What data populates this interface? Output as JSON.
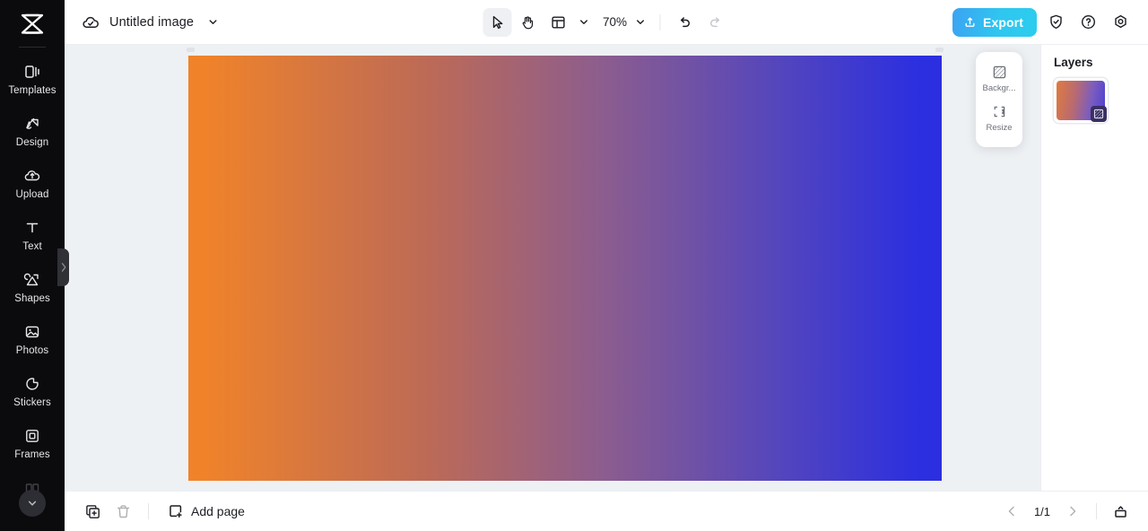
{
  "app": {
    "logo_icon": "capcut-logo-icon",
    "accent_export_from": "#3ba3f2",
    "accent_export_to": "#2ccdee",
    "canvas_gradient_from": "#f0832a",
    "canvas_gradient_to": "#2b2fe0",
    "workspace_bg": "#eef1f4",
    "sidebar_bg": "#0b0b0d"
  },
  "sidebar": {
    "items": [
      {
        "label": "Templates",
        "icon": "templates-icon"
      },
      {
        "label": "Design",
        "icon": "design-icon"
      },
      {
        "label": "Upload",
        "icon": "upload-cloud-icon"
      },
      {
        "label": "Text",
        "icon": "text-icon"
      },
      {
        "label": "Shapes",
        "icon": "shapes-icon"
      },
      {
        "label": "Photos",
        "icon": "photos-icon"
      },
      {
        "label": "Stickers",
        "icon": "stickers-icon"
      },
      {
        "label": "Frames",
        "icon": "frames-icon"
      }
    ],
    "collapse_icon": "chevron-right-icon",
    "more_icon": "chevron-down-icon"
  },
  "topbar": {
    "cloud_icon": "cloud-saved-icon",
    "doc_title": "Untitled image",
    "title_chevron_icon": "chevron-down-icon",
    "tools": [
      {
        "name": "select-tool",
        "icon": "cursor-arrow-icon",
        "active": true
      },
      {
        "name": "hand-tool",
        "icon": "hand-icon",
        "active": false
      },
      {
        "name": "layout-tool",
        "icon": "layout-grid-icon",
        "active": false
      }
    ],
    "layout_chevron_icon": "chevron-down-icon",
    "zoom_value": "70%",
    "zoom_chevron_icon": "chevron-down-icon",
    "undo_icon": "undo-arrow-icon",
    "redo_icon": "redo-arrow-icon",
    "redo_disabled": true,
    "export_label": "Export",
    "export_icon": "export-upload-icon",
    "shield_icon": "shield-check-icon",
    "help_icon": "question-circle-icon",
    "settings_icon": "gear-hex-icon"
  },
  "float_panel": {
    "items": [
      {
        "label": "Backgr...",
        "icon": "background-hatch-icon"
      },
      {
        "label": "Resize",
        "icon": "resize-icon"
      }
    ]
  },
  "right_panel": {
    "title": "Layers",
    "layer_badge_icon": "background-hatch-icon"
  },
  "bottombar": {
    "duplicate_icon": "duplicate-page-icon",
    "delete_icon": "trash-icon",
    "delete_disabled": true,
    "add_page_label": "Add page",
    "add_page_icon": "add-page-icon",
    "prev_icon": "chevron-left-icon",
    "next_icon": "chevron-right-icon",
    "page_counter": "1/1",
    "grid_view_icon": "page-grid-icon"
  }
}
